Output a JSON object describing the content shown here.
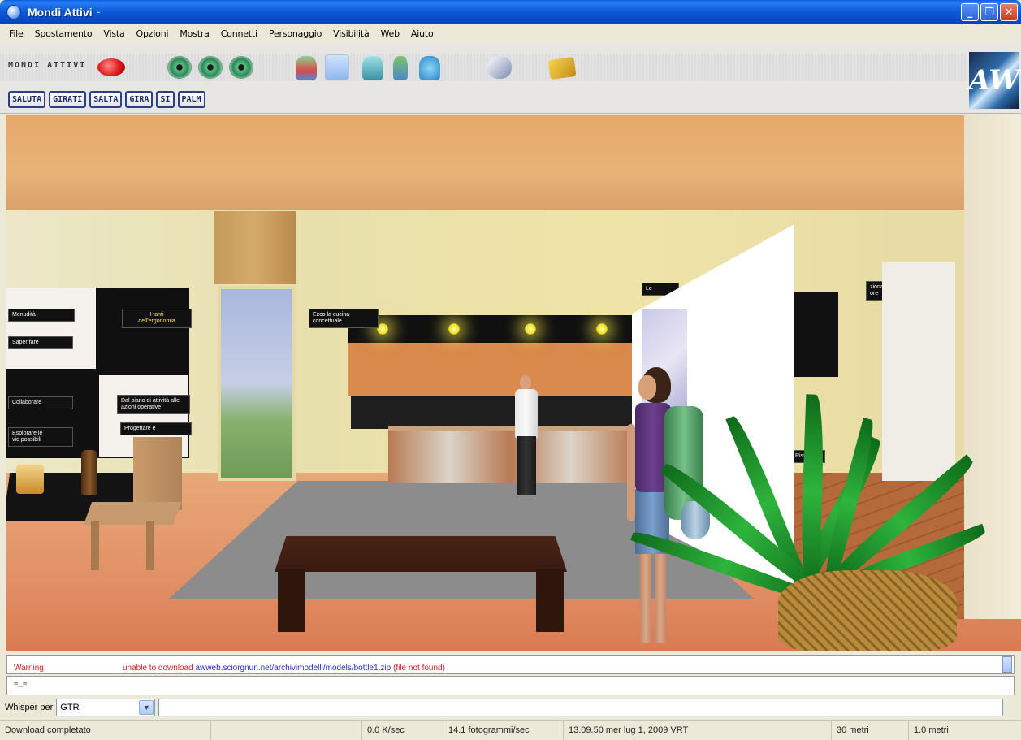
{
  "window": {
    "title": "Mondi Attivi",
    "title_separator": "-",
    "controls": {
      "minimize": "_",
      "restore": "❐",
      "close": "✕"
    }
  },
  "menu": [
    "File",
    "Spostamento",
    "Vista",
    "Opzioni",
    "Mostra",
    "Connetti",
    "Personaggio",
    "Visibilità",
    "Web",
    "Aiuto"
  ],
  "toolbar": {
    "brand": "MONDI ATTIVI",
    "aw_logo": "AW",
    "icons": [
      "camera-first-person-icon",
      "camera-follow-icon",
      "camera-front-icon",
      "avatar-icon",
      "avatar-selected-icon",
      "teleport-icon",
      "user-icon",
      "contacts-icon",
      "mouse-icon",
      "stamp-icon"
    ]
  },
  "gestures": [
    "SALUTA",
    "GIRATI",
    "SALTA",
    "GIRA",
    "SI",
    "PALM"
  ],
  "scene_signs": {
    "s1": "Menudità",
    "s2": "I tanti\ndell'ergonomia",
    "s3": "Saper fare",
    "s4": "Collaborare",
    "s5": "Dal piano di attività alle\nazioni operative",
    "s6": "Esplorare le\nvie possibili",
    "s7": "Progettare e",
    "s8": "Ecco la cucina\nconcettuale",
    "s9": "Le",
    "s10": "zionare le\nore",
    "s11": "Risultati"
  },
  "log": {
    "label": "Warning:",
    "message": "unable to download ",
    "url": "awweb.sciorgnun.net/archivimodelli/models/bottle1.zip",
    "suffix": " (file not found)"
  },
  "chat_text": "=_=",
  "whisper": {
    "label": "Whisper per",
    "selected": "GTR",
    "dropdown_icon": "▼"
  },
  "status": {
    "message": "Download completato",
    "speed": "0.0 K/sec",
    "fps": "14.1 fotogrammi/sec",
    "datetime": "13.09.50 mer lug 1, 2009 VRT",
    "visibility": "30 metri",
    "scale": "1.0 metri"
  }
}
